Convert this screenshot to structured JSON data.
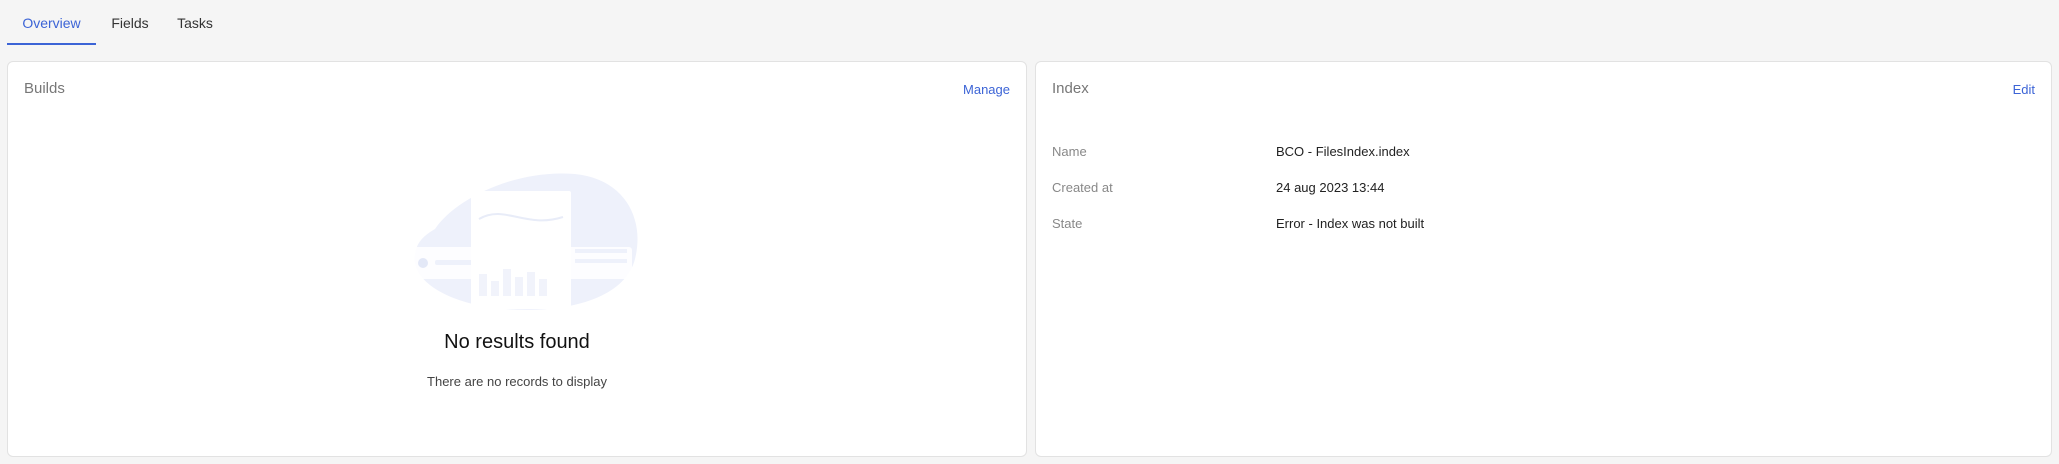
{
  "tabs": [
    {
      "label": "Overview",
      "active": true
    },
    {
      "label": "Fields",
      "active": false
    },
    {
      "label": "Tasks",
      "active": false
    }
  ],
  "builds": {
    "title": "Builds",
    "action": "Manage",
    "empty": {
      "title": "No results found",
      "subtitle": "There are no records to display"
    }
  },
  "index": {
    "title": "Index",
    "action": "Edit",
    "rows": [
      {
        "label": "Name",
        "value": "BCO - FilesIndex.index"
      },
      {
        "label": "Created at",
        "value": "24 aug 2023 13:44"
      },
      {
        "label": "State",
        "value": "Error - Index was not built"
      }
    ]
  },
  "colors": {
    "accent": "#3c64d6",
    "background": "#f5f5f5",
    "card": "#ffffff"
  }
}
